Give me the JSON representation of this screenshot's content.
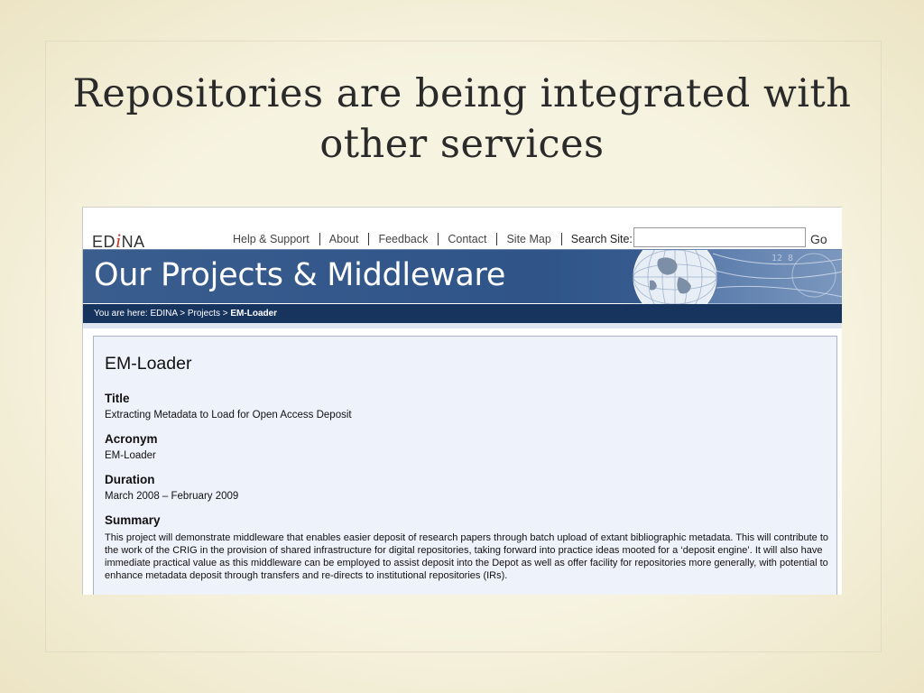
{
  "slide": {
    "title_line1": "Repositories are being integrated with",
    "title_line2": "other services"
  },
  "site": {
    "logo_prefix": "ED",
    "logo_i": "i",
    "logo_suffix": "NA",
    "nav": [
      "Help & Support",
      "About",
      "Feedback",
      "Contact",
      "Site Map"
    ],
    "search_label": "Search Site:",
    "search_value": "",
    "go_label": "Go",
    "banner_title": "Our Projects & Middleware",
    "breadcrumb_prefix": "You are here: EDINA > Projects > ",
    "breadcrumb_current": "EM-Loader",
    "colors": {
      "banner": "#2f5488",
      "breadcrumb": "#17345f",
      "content_bg": "#eef2fb",
      "logo_i": "#c0392b"
    }
  },
  "project": {
    "heading": "EM-Loader",
    "fields": [
      {
        "label": "Title",
        "value": "Extracting Metadata to Load for Open Access Deposit"
      },
      {
        "label": "Acronym",
        "value": "EM-Loader"
      },
      {
        "label": "Duration",
        "value": "March 2008 – February 2009"
      }
    ],
    "summary_label": "Summary",
    "summary_text": "This project will demonstrate middleware that enables easier deposit of research papers through batch upload of extant bibliographic metadata. This will contribute to the work of the CRIG in the provision of shared infrastructure for digital repositories, taking forward into practice ideas mooted for a ‘deposit engine’. It will also have immediate practical value as this middleware can be employed to assist deposit into the Depot as well as offer facility for repositories more generally, with potential to enhance metadata deposit through transfers and re-directs to institutional repositories (IRs)."
  }
}
